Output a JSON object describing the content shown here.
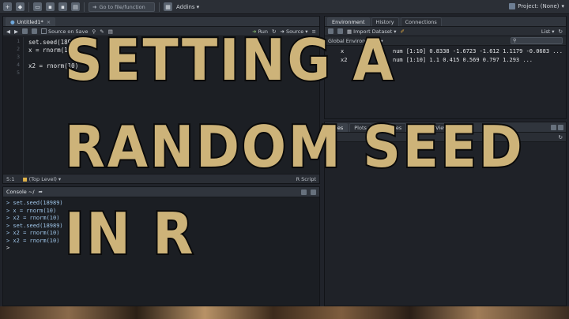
{
  "toolbar": {
    "goto_placeholder": "Go to file/function",
    "addins_label": "Addins",
    "project_label": "Project: (None)"
  },
  "editor": {
    "tab_label": "Untitled1*",
    "source_on_save_label": "Source on Save",
    "run_label": "Run",
    "source_label": "Source",
    "lines": [
      "set.seed(18989)",
      "x = rnorm(10)",
      "",
      "x2 = rnorm(10)"
    ],
    "line_numbers": [
      "1",
      "2",
      "3",
      "4",
      "5"
    ],
    "status_position": "5:1",
    "status_scope": "(Top Level)",
    "status_filetype": "R Script"
  },
  "console": {
    "title": "Console ~/",
    "lines": [
      "> set.seed(18989)",
      "> x = rnorm(10)",
      "> x2 = rnorm(10)",
      "> set.seed(18989)",
      "> x2 = rnorm(10)",
      "> x2 = rnorm(10)",
      ">"
    ]
  },
  "environment": {
    "tabs": [
      "Environment",
      "History",
      "Connections"
    ],
    "import_label": "Import Dataset",
    "list_label": "List",
    "scope_label": "Global Environment",
    "rows": [
      {
        "name": "x",
        "value": "num [1:10] 0.8338 -1.6723 -1.612 1.1179 -0.0683 ..."
      },
      {
        "name": "x2",
        "value": "num [1:10] 1.1 0.415 0.569 0.797 1.293 ..."
      }
    ]
  },
  "files": {
    "tabs": [
      "Files",
      "Plots",
      "Packages",
      "Help",
      "Viewer"
    ]
  },
  "overlay": {
    "line1": "SETTING A",
    "line2": "RANDOM SEED",
    "line3": "IN R"
  }
}
